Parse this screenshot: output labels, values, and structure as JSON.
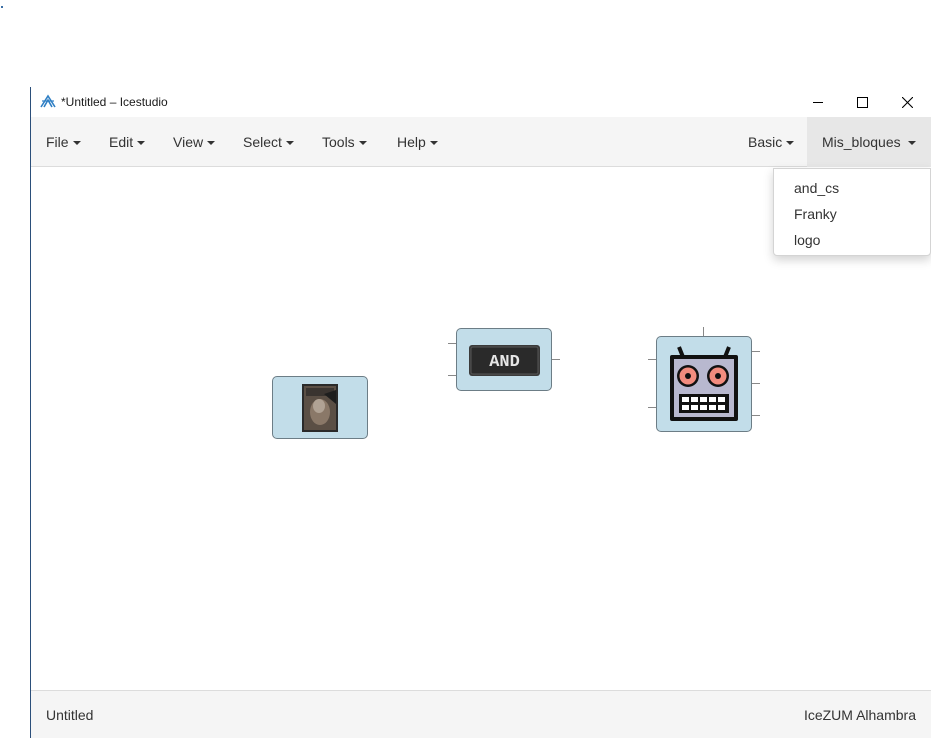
{
  "window": {
    "title": "*Untitled – Icestudio",
    "controls": {
      "minimize": "minimize-icon",
      "maximize": "maximize-icon",
      "close": "close-icon"
    }
  },
  "menubar": {
    "left": [
      {
        "label": "File"
      },
      {
        "label": "Edit"
      },
      {
        "label": "View"
      },
      {
        "label": "Select"
      },
      {
        "label": "Tools"
      },
      {
        "label": "Help"
      }
    ],
    "right": [
      {
        "label": "Basic"
      },
      {
        "label": "Mis_bloques",
        "open": true
      }
    ]
  },
  "dropdown": {
    "items": [
      {
        "label": "and_cs"
      },
      {
        "label": "Franky"
      },
      {
        "label": "logo"
      }
    ]
  },
  "canvas": {
    "blocks": [
      {
        "name": "photo-block",
        "icon": "photo-image"
      },
      {
        "name": "and-gate-block",
        "icon": "and-gate-icon",
        "text": "AND"
      },
      {
        "name": "robot-block",
        "icon": "robot-icon"
      }
    ]
  },
  "status": {
    "project": "Untitled",
    "board": "IceZUM Alhambra"
  },
  "colors": {
    "block_fill": "#c2dde9",
    "menubar_bg": "#f5f5f5",
    "open_menu_bg": "#e7e7e7"
  }
}
